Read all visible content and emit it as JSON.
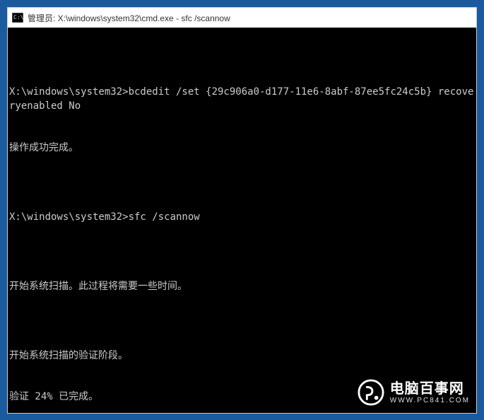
{
  "window": {
    "title": "管理员: X:\\windows\\system32\\cmd.exe - sfc  /scannow"
  },
  "terminal": {
    "lines": [
      "",
      "X:\\windows\\system32>bcdedit /set {29c906a0-d177-11e6-8abf-87ee5fc24c5b} recoveryenabled No",
      "操作成功完成。",
      "",
      "X:\\windows\\system32>sfc /scannow",
      "",
      "开始系统扫描。此过程将需要一些时间。",
      "",
      "开始系统扫描的验证阶段。",
      "验证 24% 已完成。"
    ]
  },
  "watermark": {
    "name_cn": "电脑百事网",
    "url": "WWW.PC841.COM"
  }
}
